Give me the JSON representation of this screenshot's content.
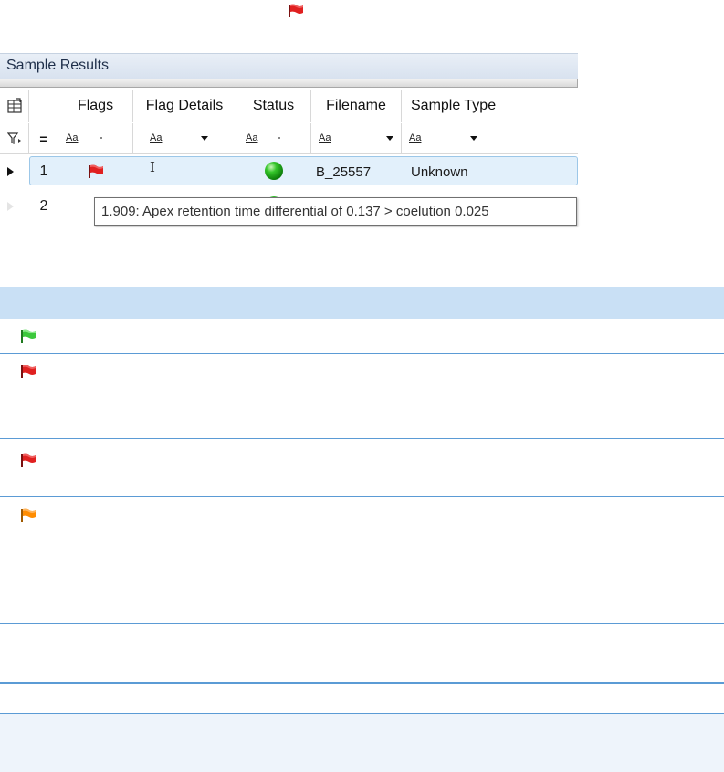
{
  "top_flag": {
    "icon": "red-flag-icon",
    "color": "#e02020"
  },
  "panel": {
    "title": "Sample Results",
    "columns": [
      "Flags",
      "Flag Details",
      "Status",
      "Filename",
      "Sample Type"
    ],
    "filter_label": "Aa",
    "filter_row_equals": "=",
    "rows": [
      {
        "number": "1",
        "flag": "red-flag-icon",
        "flag_details_cursor": "I",
        "status": "green-status-icon",
        "filename": "B_25557",
        "sample_type": "Unknown"
      },
      {
        "number": "2"
      }
    ],
    "tooltip": "1.909: Apex retention time differential of 0.137 > coelution 0.025"
  },
  "legend_table": {
    "rows": [
      {
        "icon": "green-flag-icon",
        "color": "#3cc83c"
      },
      {
        "icon": "red-flag-icon",
        "color": "#e02020"
      },
      {
        "icon": "red-flag-icon",
        "color": "#e02020"
      },
      {
        "icon": "orange-flag-icon",
        "color": "#ff8c00"
      }
    ]
  }
}
